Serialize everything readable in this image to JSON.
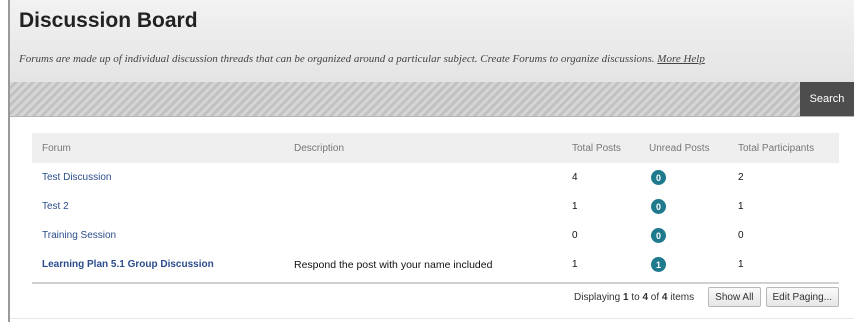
{
  "header": {
    "title": "Discussion Board",
    "subtitle": "Forums are made up of individual discussion threads that can be organized around a particular subject. Create Forums to organize discussions.",
    "help_link": "More Help"
  },
  "toolbar": {
    "search_label": "Search"
  },
  "table": {
    "columns": {
      "forum": "Forum",
      "description": "Description",
      "total_posts": "Total Posts",
      "unread_posts": "Unread Posts",
      "total_participants": "Total Participants"
    },
    "rows": [
      {
        "forum": "Test Discussion",
        "description": "",
        "total_posts": "4",
        "unread_posts": "0",
        "total_participants": "2"
      },
      {
        "forum": "Test 2",
        "description": "",
        "total_posts": "1",
        "unread_posts": "0",
        "total_participants": "1"
      },
      {
        "forum": "Training Session",
        "description": "",
        "total_posts": "0",
        "unread_posts": "0",
        "total_participants": "0"
      },
      {
        "forum": "Learning Plan 5.1 Group Discussion",
        "description": "Respond the post with your name included",
        "total_posts": "1",
        "unread_posts": "1",
        "total_participants": "1"
      }
    ]
  },
  "footer": {
    "displaying_prefix": "Displaying",
    "range_start": "1",
    "to": "to",
    "range_end": "4",
    "of": "of",
    "total": "4",
    "items": "items",
    "show_all_label": "Show All",
    "edit_paging_label": "Edit Paging..."
  },
  "colors": {
    "badge": "#1e7a8c",
    "link": "#2b4d8c",
    "search_button": "#4d4d4d"
  }
}
